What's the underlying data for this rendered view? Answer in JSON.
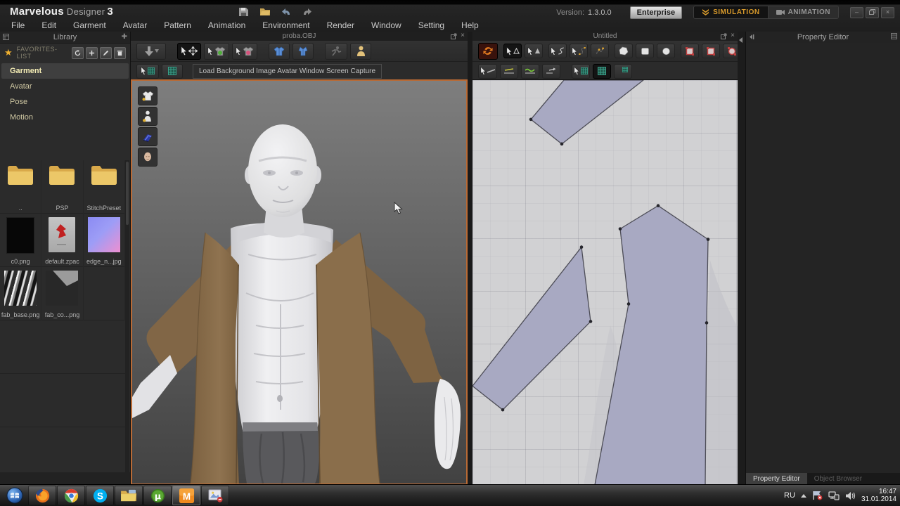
{
  "titlebar": {
    "brand_word1": "Marvelous",
    "brand_word2": "Designer",
    "brand_word3": "3",
    "version_label": "Version:",
    "version_value": "1.3.0.0",
    "enterprise_label": "Enterprise",
    "simulation_label": "SIMULATION",
    "animation_label": "ANIMATION",
    "minimize_glyph": "–",
    "close_glyph": "×"
  },
  "menubar": {
    "items": [
      "File",
      "Edit",
      "Garment",
      "Avatar",
      "Pattern",
      "Animation",
      "Environment",
      "Render",
      "Window",
      "Setting",
      "Help"
    ]
  },
  "library": {
    "title": "Library",
    "favorites_label": "FAVORITES-LIST",
    "star_glyph": "★",
    "items": [
      {
        "label": "Garment",
        "selected": true
      },
      {
        "label": "Avatar",
        "selected": false
      },
      {
        "label": "Pose",
        "selected": false
      },
      {
        "label": "Motion",
        "selected": false
      }
    ],
    "thumbnails": [
      {
        "label": "..",
        "kind": "folder"
      },
      {
        "label": "PSP",
        "kind": "folder"
      },
      {
        "label": "StitchPreset",
        "kind": "folder"
      },
      {
        "label": "c0.png",
        "kind": "black-image"
      },
      {
        "label": "default.zpac",
        "kind": "garment-file"
      },
      {
        "label": "edge_n...jpg",
        "kind": "normal-map-image"
      },
      {
        "label": "fab_base.png",
        "kind": "fabric-image"
      },
      {
        "label": "fab_co...png",
        "kind": "fabric-image"
      }
    ]
  },
  "window3d": {
    "title": "proba.OBJ",
    "tooltip": "Load Background Image Avatar Window Screen Capture",
    "close_glyph": "×"
  },
  "window2d": {
    "title": "Untitled",
    "close_glyph": "×"
  },
  "property_panel": {
    "title": "Property Editor",
    "tabs": [
      {
        "label": "Property Editor",
        "active": true
      },
      {
        "label": "Object Browser",
        "active": false
      }
    ]
  },
  "taskbar": {
    "language": "RU",
    "time": "16:47",
    "date": "31.01.2014"
  },
  "colors": {
    "viewport_border": "#b96a35",
    "simulation_accent": "#d89a2b",
    "pattern_fill": "#a8a9c2",
    "canvas_bg": "#d1d1d3",
    "robe_brown": "#8a6e4b"
  }
}
